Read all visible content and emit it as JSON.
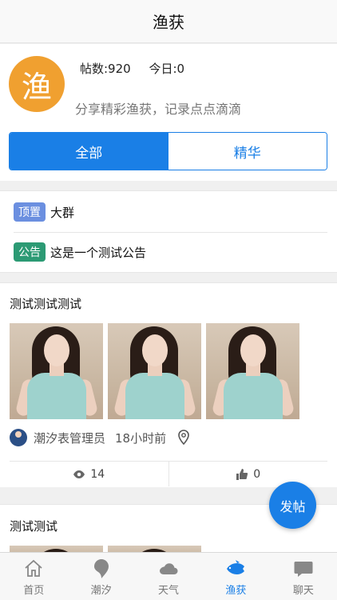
{
  "header": {
    "title": "渔获"
  },
  "forum": {
    "logo_text": "渔",
    "posts_label": "帖数:920",
    "today_label": "今日:0",
    "description": "分享精彩渔获，记录点点滴滴"
  },
  "segments": {
    "all": "全部",
    "featured": "精华"
  },
  "notices": [
    {
      "tag": "顶置",
      "text": "大群"
    },
    {
      "tag": "公告",
      "text": "这是一个测试公告"
    }
  ],
  "post": {
    "title": "测试测试测试",
    "author": "潮汐表管理员",
    "time": "18小时前",
    "views": "14",
    "likes": "0"
  },
  "post2": {
    "title": "测试测试"
  },
  "fab": {
    "label": "发帖"
  },
  "tabs": [
    {
      "label": "首页",
      "icon": "home-icon"
    },
    {
      "label": "潮汐",
      "icon": "drop-icon"
    },
    {
      "label": "天气",
      "icon": "cloud-icon"
    },
    {
      "label": "渔获",
      "icon": "fish-icon",
      "active": true
    },
    {
      "label": "聊天",
      "icon": "chat-icon"
    }
  ],
  "colors": {
    "accent": "#1a7fe6",
    "logo": "#f0a030",
    "tag_top": "#6b8fe0",
    "tag_announce": "#2c9a74"
  }
}
